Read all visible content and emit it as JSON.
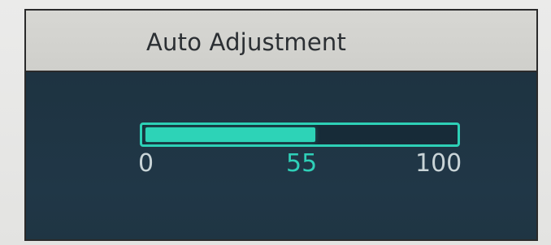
{
  "osd": {
    "title": "Auto Adjustment",
    "progress": {
      "min": "0",
      "current": "55",
      "max": "100",
      "fraction": 0.55
    },
    "colors": {
      "accent": "#2dd3b7",
      "background": "#203747",
      "header": "#d3d3cf"
    }
  }
}
